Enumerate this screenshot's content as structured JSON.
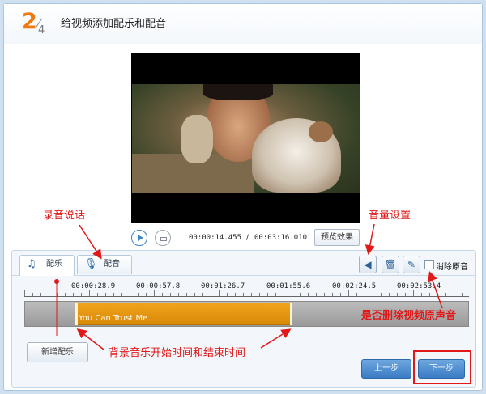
{
  "header": {
    "step_current": "2",
    "step_total": "4",
    "title": "给视频添加配乐和配音"
  },
  "player": {
    "time_current": "00:00:14.455",
    "time_separator": "/",
    "time_total": "00:03:16.010",
    "preview_label": "预览效果",
    "play_icon": "play-icon",
    "stop_icon": "stop-icon"
  },
  "tabs": [
    {
      "label": "配乐",
      "icon": "music-note-icon",
      "active": true
    },
    {
      "label": "配音",
      "icon": "microphone-icon",
      "active": false
    }
  ],
  "toolbar": {
    "volume_icon": "speaker-icon",
    "delete_icon": "trash-icon",
    "clean_icon": "broom-icon",
    "mute_original_label": "消除原音",
    "mute_original_checked": false
  },
  "timeline": {
    "ticks": [
      "00:00:28.9",
      "00:00:57.8",
      "00:01:26.7",
      "00:01:55.6",
      "00:02:24.5",
      "00:02:53.4"
    ],
    "clip_label": "You Can Trust Me"
  },
  "buttons": {
    "add_music": "新增配乐",
    "prev_step": "上一步",
    "next_step": "下一步"
  },
  "annotations": {
    "record": "录音说话",
    "volume": "音量设置",
    "delete_original": "是否删除视频原声音",
    "start_end": "背景音乐开始时间和结束时间",
    "color": "#e01818"
  },
  "colors": {
    "accent_orange": "#f07a12",
    "clip_orange": "#e59612",
    "button_blue": "#3a7bc4"
  }
}
